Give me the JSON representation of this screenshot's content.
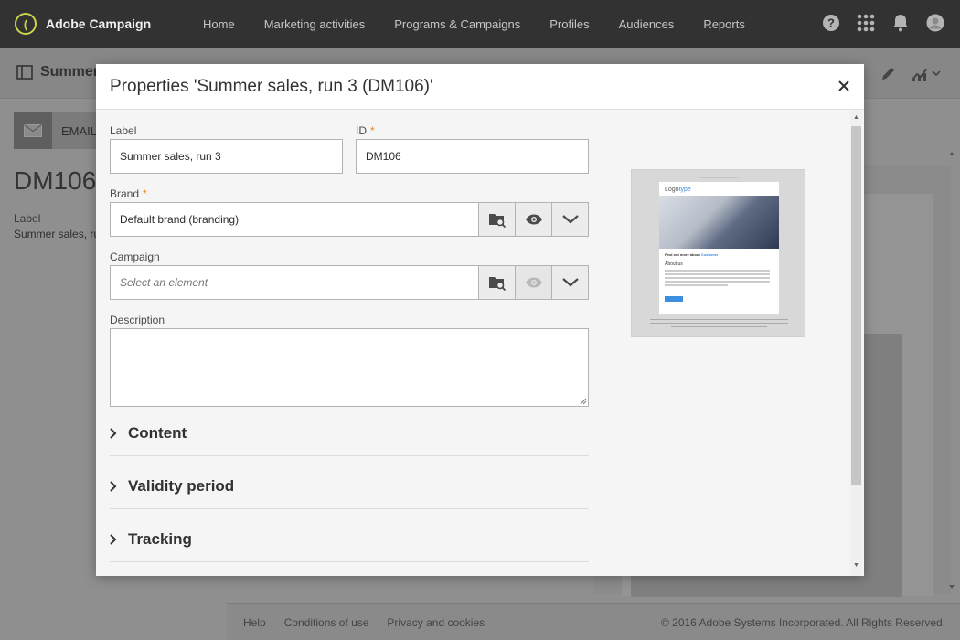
{
  "app": {
    "name": "Adobe Campaign",
    "logo_glyph": "("
  },
  "nav": {
    "items": [
      "Home",
      "Marketing activities",
      "Programs & Campaigns",
      "Profiles",
      "Audiences",
      "Reports"
    ],
    "icons": [
      "help-icon",
      "apps-grid-icon",
      "bell-icon",
      "user-avatar-icon"
    ]
  },
  "background": {
    "page_title": "Summer",
    "channel_label": "EMAIL",
    "delivery_code": "DM106",
    "label_caption": "Label",
    "label_value": "Summer sales, ru",
    "footer_links": [
      "Help",
      "Conditions of use",
      "Privacy and cookies"
    ],
    "copyright": "© 2016 Adobe Systems Incorporated. All Rights Reserved."
  },
  "modal": {
    "title": "Properties 'Summer sales, run 3 (DM106)'",
    "fields": {
      "label": {
        "caption": "Label",
        "value": "Summer sales, run 3"
      },
      "id": {
        "caption": "ID",
        "required_mark": "*",
        "value": "DM106"
      },
      "brand": {
        "caption": "Brand",
        "required_mark": "*",
        "value": "Default brand (branding)"
      },
      "campaign": {
        "caption": "Campaign",
        "placeholder": "Select an element"
      },
      "description": {
        "caption": "Description",
        "value": ""
      }
    },
    "sections": [
      "Content",
      "Validity period",
      "Tracking"
    ],
    "preview": {
      "logo_text_dark": "Logo",
      "logo_text_blue": "type",
      "headline_dark": "Find out more about",
      "headline_blue": "Customer",
      "subheading": "About us"
    }
  },
  "colors": {
    "required": "#e68619",
    "topbar": "#323232",
    "accent": "#3d8ee0"
  }
}
